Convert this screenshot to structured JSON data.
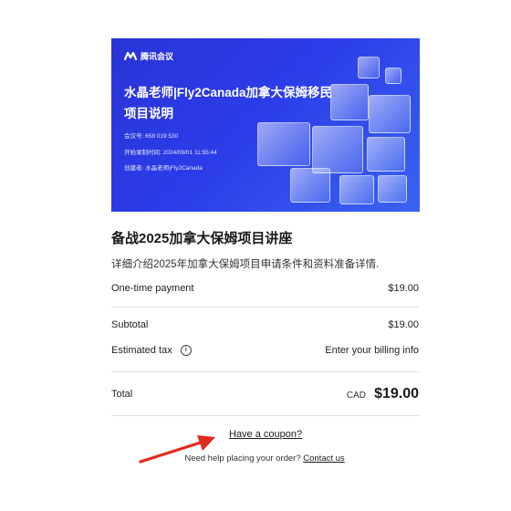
{
  "banner": {
    "brand": "腾讯会议",
    "title": "水晶老师|Fly2Canada加拿大保姆移民项目说明",
    "meeting_id_label": "会议号:",
    "meeting_id": "658 019 530",
    "record_time_label": "开始录制时间:",
    "record_time": "2024/09/01 11:55:44",
    "creator_label": "创建者:",
    "creator": "水晶老师|Fly2Canada"
  },
  "course": {
    "title": "备战2025加拿大保姆项目讲座",
    "description": "详细介绍2025年加拿大保姆项目申请条件和资料准备详情."
  },
  "summary": {
    "payment_label": "One-time payment",
    "payment_value": "$19.00",
    "subtotal_label": "Subtotal",
    "subtotal_value": "$19.00",
    "tax_label": "Estimated tax",
    "tax_value": "Enter your billing info",
    "total_label": "Total",
    "total_currency": "CAD",
    "total_value": "$19.00"
  },
  "coupon_link": "Have a coupon?",
  "help": {
    "text": "Need help placing your order?",
    "link": "Contact us"
  },
  "icons": {
    "info": "info-icon",
    "arrow": "red-arrow-icon",
    "logo": "tencent-meeting-logo-icon"
  },
  "colors": {
    "banner_blue": "#2b3ce8",
    "arrow_red": "#e02a1f"
  }
}
